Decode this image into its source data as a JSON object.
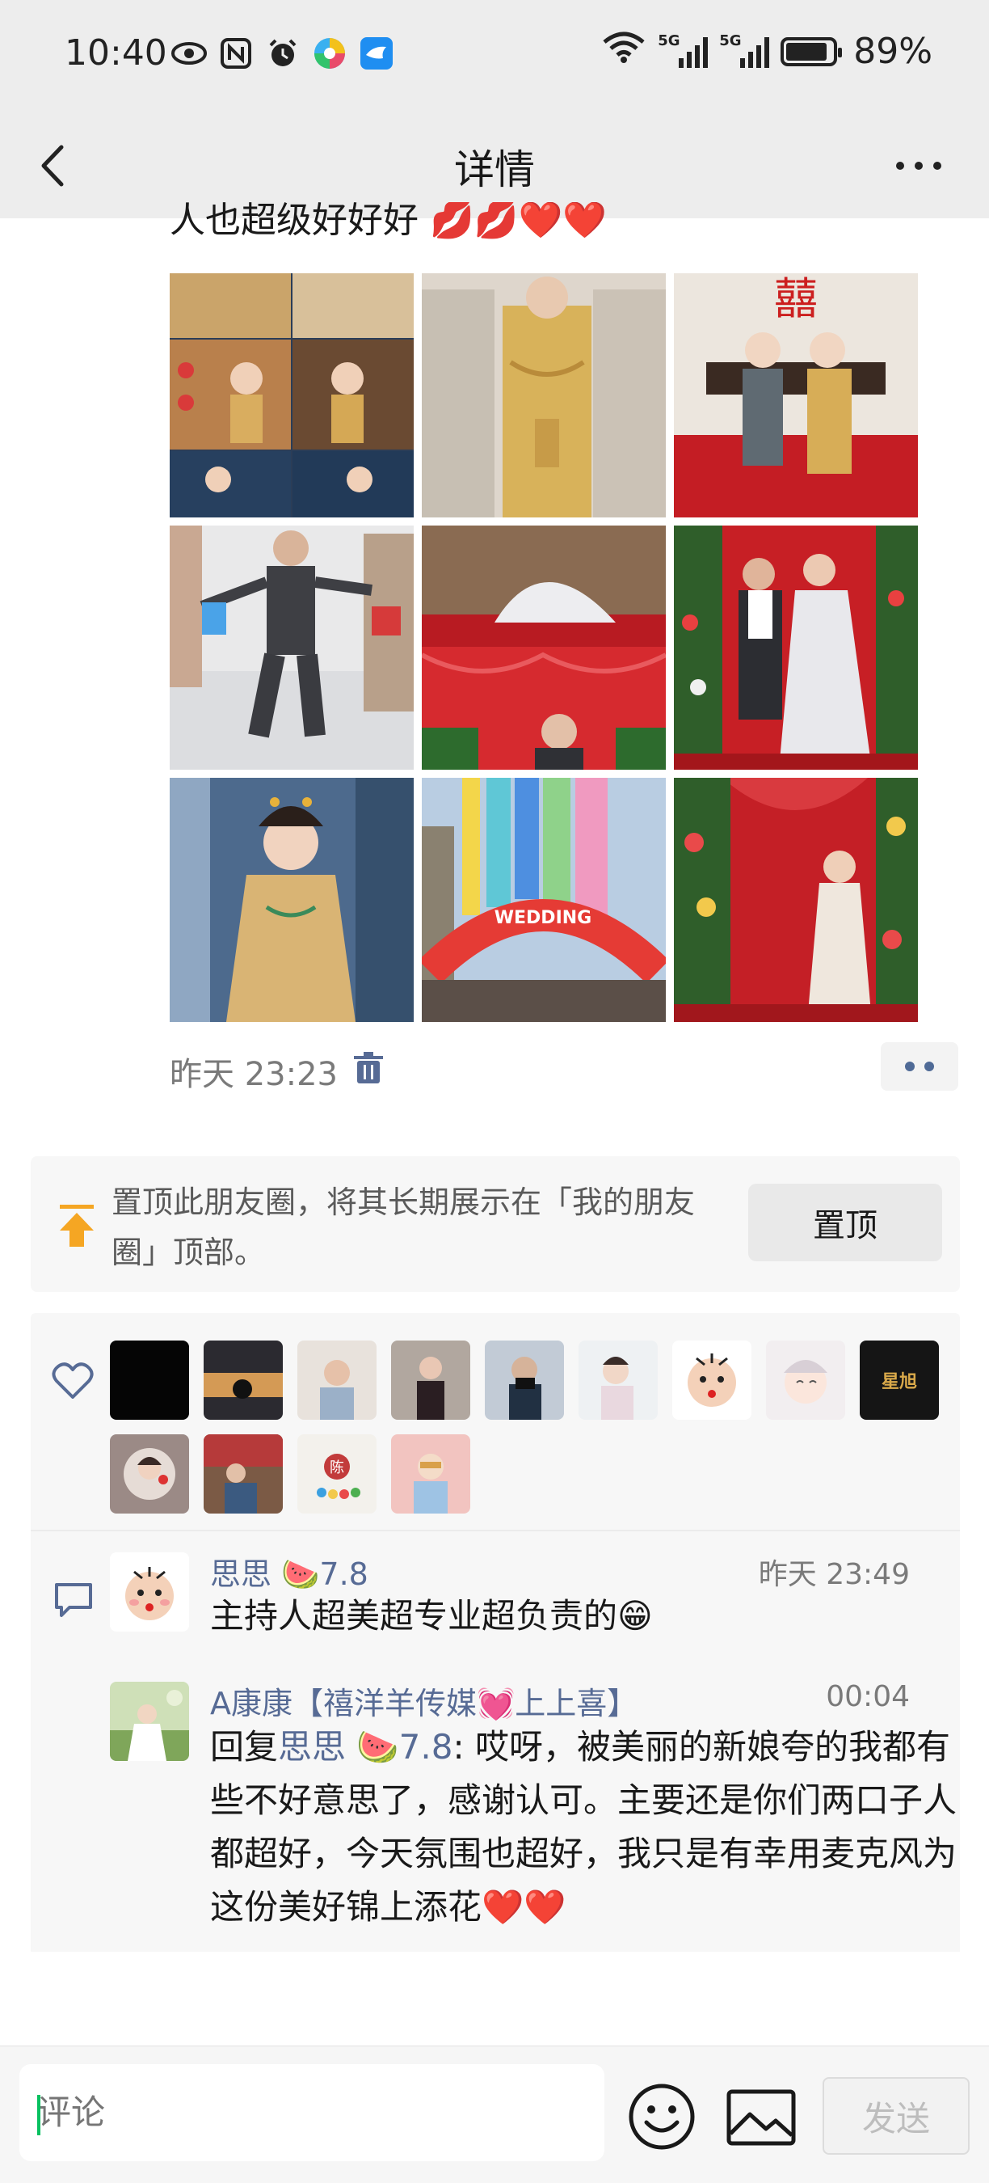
{
  "status_bar": {
    "time": "10:40",
    "left_icons": [
      "eye-icon",
      "nfc-icon",
      "alarm-icon",
      "colorful-app-icon",
      "bird-app-icon"
    ],
    "network_labels": [
      "5G",
      "5G"
    ],
    "battery_percent": "89%",
    "battery_level": 0.89
  },
  "nav": {
    "title": "详情"
  },
  "post": {
    "text_visible": "人也超级好好好",
    "time": "昨天 23:23"
  },
  "pin": {
    "text": "置顶此朋友圈，将其长期展示在「我的朋友圈」顶部。",
    "button_label": "置顶"
  },
  "likes": {
    "avatar_count": 13
  },
  "comments": [
    {
      "name": "思思 🍉7.8",
      "time": "昨天 23:49",
      "text": "主持人超美超专业超负责的😁"
    },
    {
      "name": "A康康【禧洋羊传媒💓上上喜】",
      "time": "00:04",
      "reply_prefix": "回复",
      "reply_to": "思思 🍉7.8",
      "text": ": 哎呀，被美丽的新娘夸的我都有些不好意思了，感谢认可。主要还是你们两口子人都超好，今天氛围也超好，我只是有幸用麦克风为这份美好锦上添花❤️❤️"
    }
  ],
  "composer": {
    "placeholder": "评论",
    "send_label": "发送"
  },
  "colors": {
    "link": "#576b95",
    "bar_bg": "#ededed",
    "card_bg": "#f7f7f7",
    "accent_pin": "#f5a623"
  }
}
